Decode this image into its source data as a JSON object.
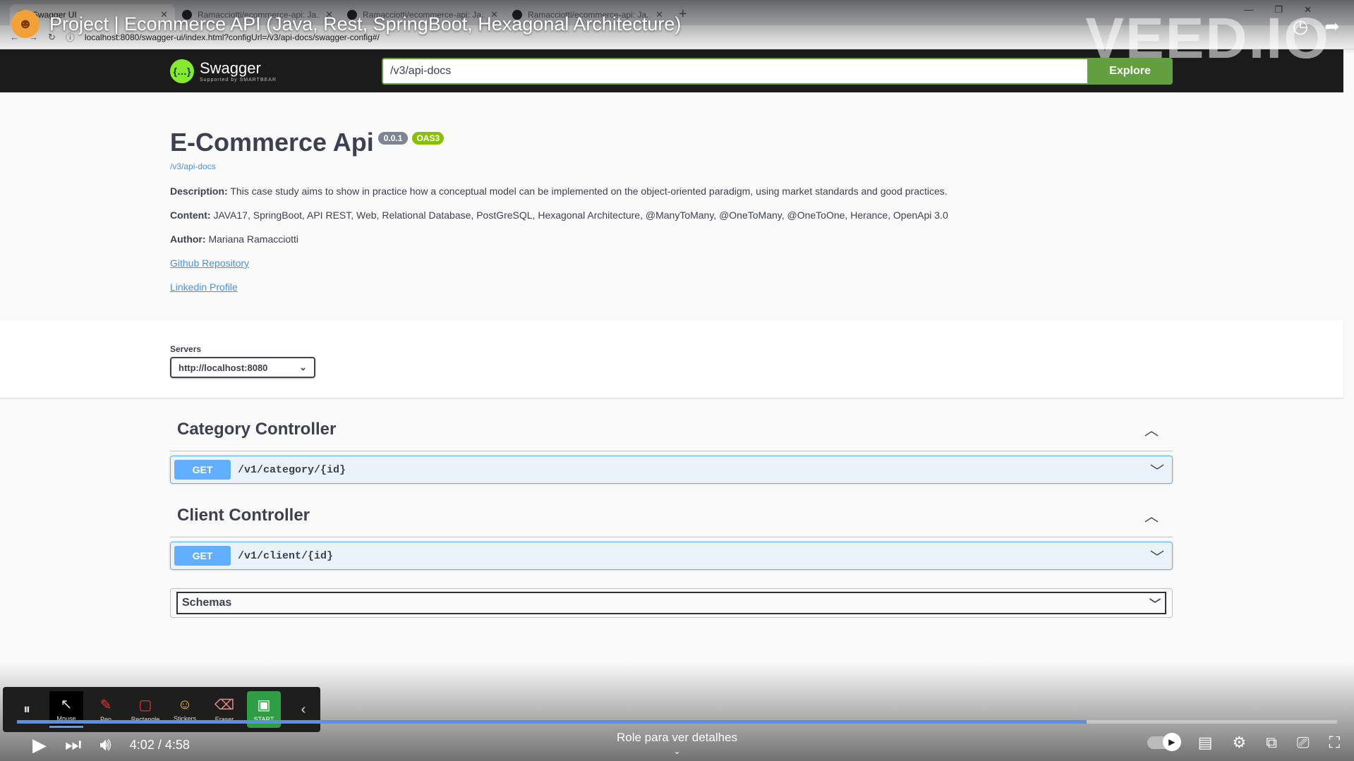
{
  "browser": {
    "tabs": [
      {
        "label": "Swagger UI"
      },
      {
        "label": "Ramacciotti/ecommerce-api: Ja..."
      },
      {
        "label": "Ramacciotti/ecommerce-api: Ja..."
      },
      {
        "label": "Ramacciotti/ecommerce-api: Ja..."
      }
    ],
    "url": "localhost:8080/swagger-ui/index.html?configUrl=/v3/api-docs/swagger-config#/"
  },
  "video": {
    "title": "Project | Ecommerce API (Java, Rest, SpringBoot, Hexagonal Architecture)",
    "watermark": "VEED.IO",
    "time": "4:02 / 4:58",
    "progress": 0.81,
    "more_label": "Role para ver detalhes"
  },
  "swagger": {
    "brand": "Swagger",
    "brand_sub": "Supported by SMARTBEAR",
    "search_value": "/v3/api-docs",
    "explore_label": "Explore"
  },
  "info": {
    "title": "E-Commerce Api",
    "version": "0.0.1",
    "oas": "OAS3",
    "doc_link": "/v3/api-docs",
    "description_label": "Description:",
    "description": "This case study aims to show in practice how a conceptual model can be implemented on the object-oriented paradigm, using market standards and good practices.",
    "content_label": "Content:",
    "content": "JAVA17, SpringBoot, API REST, Web, Relational Database, PostGreSQL, Hexagonal Architecture, @ManyToMany, @OneToMany, @OneToOne, Herance, OpenApi 3.0",
    "author_label": "Author:",
    "author": "Mariana Ramacciotti",
    "github_link": "Github Repository",
    "linkedin_link": "Linkedin Profile"
  },
  "servers": {
    "label": "Servers",
    "selected": "http://localhost:8080"
  },
  "controllers": [
    {
      "name": "Category Controller",
      "method": "GET",
      "path": "/v1/category/{id}"
    },
    {
      "name": "Client Controller",
      "method": "GET",
      "path": "/v1/client/{id}"
    }
  ],
  "schemas_label": "Schemas",
  "toolbar": {
    "tools": [
      "Mouse",
      "Pen",
      "Rectangle",
      "Stickers",
      "Eraser",
      "START"
    ]
  },
  "colors": {
    "get": "#61affe",
    "swagger_green": "#85ea2d",
    "explore": "#62a03f",
    "oas": "#89bf04"
  }
}
